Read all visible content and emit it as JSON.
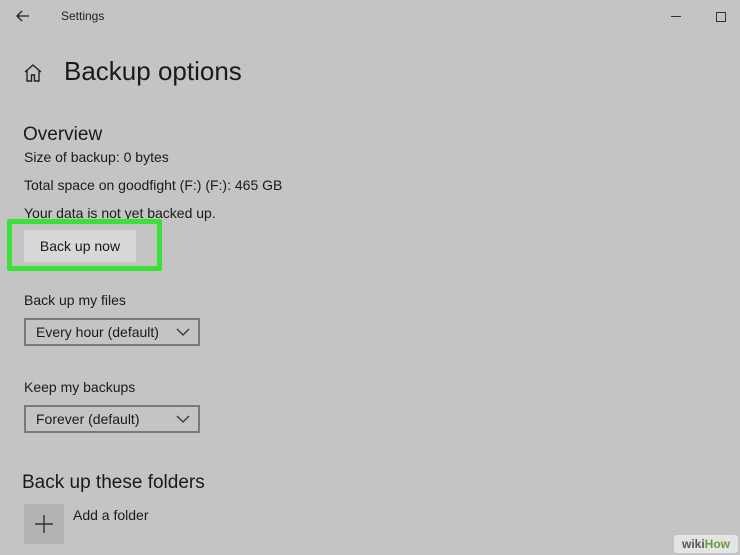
{
  "window": {
    "title": "Settings"
  },
  "header": {
    "page_title": "Backup options"
  },
  "overview": {
    "heading": "Overview",
    "size_of_backup": "Size of backup: 0 bytes",
    "total_space": "Total space on goodfight (F:) (F:): 465 GB",
    "status": "Your data is not yet backed up.",
    "back_up_now_label": "Back up now"
  },
  "back_up_files": {
    "label": "Back up my files",
    "selected": "Every hour (default)"
  },
  "keep_backups": {
    "label": "Keep my backups",
    "selected": "Forever (default)"
  },
  "folders": {
    "heading": "Back up these folders",
    "add_folder_label": "Add a folder"
  },
  "watermark": {
    "part1": "wiki",
    "part2": "How"
  },
  "colors": {
    "background": "#c4c4c4",
    "highlight": "#3ae13a",
    "button": "#d8d8d8"
  },
  "icons": {
    "back": "back-arrow-icon",
    "home": "home-icon",
    "minimize": "minimize-icon",
    "maximize": "maximize-icon",
    "chevron": "chevron-down-icon",
    "add": "plus-icon"
  }
}
